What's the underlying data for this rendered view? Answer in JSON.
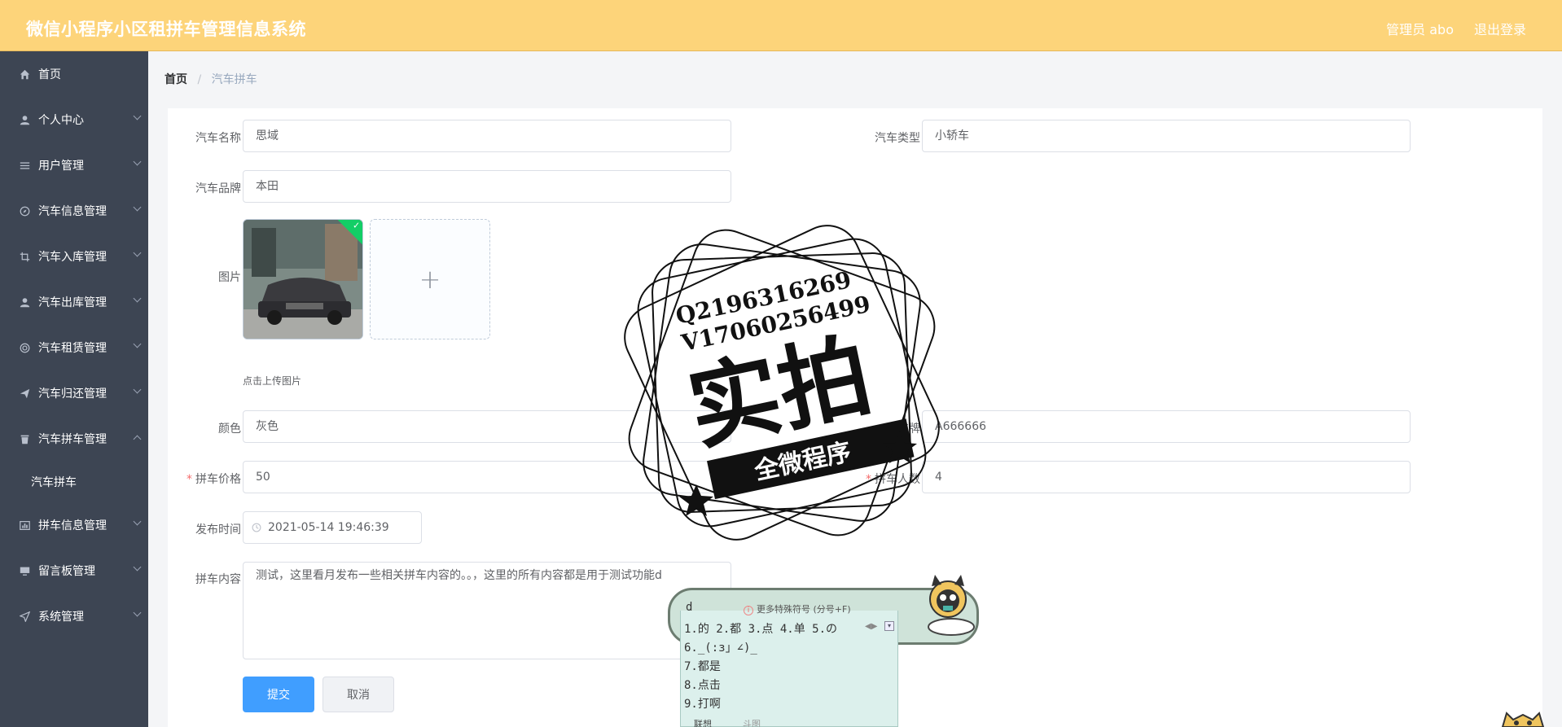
{
  "header": {
    "title": "微信小程序小区租拼车管理信息系统",
    "admin": "管理员 abo",
    "logout": "退出登录"
  },
  "sidebar": {
    "items": [
      {
        "label": "首页",
        "icon": "home-icon"
      },
      {
        "label": "个人中心",
        "icon": "user-icon"
      },
      {
        "label": "用户管理",
        "icon": "list-icon"
      },
      {
        "label": "汽车信息管理",
        "icon": "compass-icon"
      },
      {
        "label": "汽车入库管理",
        "icon": "crop-icon"
      },
      {
        "label": "汽车出库管理",
        "icon": "user-icon"
      },
      {
        "label": "汽车租赁管理",
        "icon": "circle-icon"
      },
      {
        "label": "汽车归还管理",
        "icon": "send-icon"
      },
      {
        "label": "汽车拼车管理",
        "icon": "trash-icon"
      },
      {
        "label": "汽车拼车",
        "icon": ""
      },
      {
        "label": "拼车信息管理",
        "icon": "chart-icon"
      },
      {
        "label": "留言板管理",
        "icon": "monitor-icon"
      },
      {
        "label": "系统管理",
        "icon": "navigation-icon"
      }
    ]
  },
  "breadcrumb": {
    "home": "首页",
    "sep": "/",
    "current": "汽车拼车"
  },
  "form": {
    "car_name_label": "汽车名称",
    "car_name": "思域",
    "car_type_label": "汽车类型",
    "car_type": "小轿车",
    "car_brand_label": "汽车品牌",
    "car_brand": "本田",
    "image_label": "图片",
    "upload_tip": "点击上传图片",
    "color_label": "颜色",
    "color": "灰色",
    "plate_label": "车牌",
    "plate": "A666666",
    "price_label": "拼车价格",
    "price": "50",
    "people_label": "拼车人数",
    "people": "4",
    "time_label": "发布时间",
    "time": "2021-05-14 19:46:39",
    "content_label": "拼车内容",
    "content": "测试，这里看月发布一些相关拼车内容的。。，这里的所有内容都是用于测试功能d",
    "submit": "提交",
    "cancel": "取消",
    "required_mark": "*",
    "add_symbol": "+",
    "check_mark": "✓"
  },
  "watermark": {
    "line1": "Q2196316269",
    "line2": "V17060256499",
    "main": "实拍",
    "banner": "全微程序"
  },
  "ime": {
    "input": "d",
    "hint": "更多特殊符号 (分号+F)",
    "row1": "1.的  2.都  3.点  4.单  5.の",
    "c6": "6._(:з」∠)_",
    "c7": "7.都是",
    "c8": "8.点击",
    "c9": "9.打啊",
    "tab1": "联想",
    "tab2": "斗图"
  }
}
